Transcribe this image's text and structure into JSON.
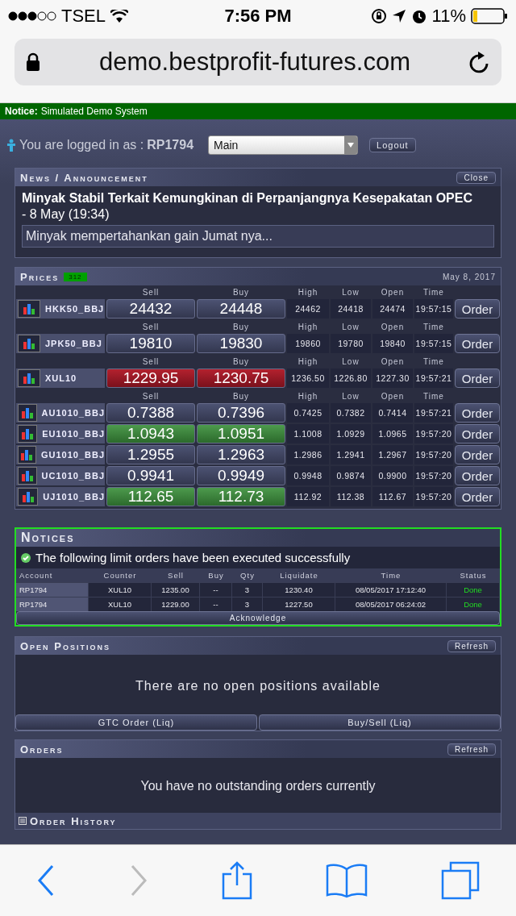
{
  "status_bar": {
    "carrier": "TSEL",
    "time": "7:56 PM",
    "battery": "11%"
  },
  "address_bar": {
    "url": "demo.bestprofit-futures.com"
  },
  "notice_bar": {
    "label": "Notice:",
    "text": "Simulated Demo System"
  },
  "login": {
    "prefix": "You are logged in as :",
    "account": "RP1794",
    "account_select": "Main",
    "logout": "Logout"
  },
  "news": {
    "title": "News / Announcement",
    "close": "Close",
    "headline": "Minyak Stabil Terkait Kemungkinan di Perpanjangnya Kesepakatan OPEC",
    "date": "- 8 May (19:34)",
    "summary": "Minyak mempertahankan gain Jumat nya..."
  },
  "prices": {
    "title": "Prices",
    "badge": "312",
    "date": "May 8, 2017",
    "rows": [
      {
        "headers": [
          "Sell",
          "Buy",
          "High",
          "Low",
          "Open",
          "Time"
        ],
        "symbol": "HKK50_BBJ",
        "sell": "24432",
        "buy": "24448",
        "high": "24462",
        "low": "24418",
        "open": "24474",
        "time": "19:57:15",
        "kind": "plain",
        "order": "Order"
      },
      {
        "headers": [
          "Sell",
          "Buy",
          "High",
          "Low",
          "Open",
          "Time"
        ],
        "symbol": "JPK50_BBJ",
        "sell": "19810",
        "buy": "19830",
        "high": "19860",
        "low": "19780",
        "open": "19840",
        "time": "19:57:15",
        "kind": "plain",
        "order": "Order"
      },
      {
        "headers": [
          "Sell",
          "Buy",
          "High",
          "Low",
          "Open",
          "Time"
        ],
        "symbol": "XUL10",
        "sell": "1229.95",
        "buy": "1230.75",
        "high": "1236.50",
        "low": "1226.80",
        "open": "1227.30",
        "time": "19:57:21",
        "kind": "down",
        "order": "Order"
      },
      {
        "headers": [
          "Sell",
          "Buy",
          "High",
          "Low",
          "Open",
          "Time"
        ],
        "symbol": "AU1010_BBJ",
        "sell": "0.7388",
        "buy": "0.7396",
        "high": "0.7425",
        "low": "0.7382",
        "open": "0.7414",
        "time": "19:57:21",
        "kind": "plain",
        "order": "Order"
      },
      {
        "symbol": "EU1010_BBJ",
        "sell": "1.0943",
        "buy": "1.0951",
        "high": "1.1008",
        "low": "1.0929",
        "open": "1.0965",
        "time": "19:57:20",
        "kind": "up",
        "order": "Order"
      },
      {
        "symbol": "GU1010_BBJ",
        "sell": "1.2955",
        "buy": "1.2963",
        "high": "1.2986",
        "low": "1.2941",
        "open": "1.2967",
        "time": "19:57:20",
        "kind": "plain",
        "order": "Order"
      },
      {
        "symbol": "UC1010_BBJ",
        "sell": "0.9941",
        "buy": "0.9949",
        "high": "0.9948",
        "low": "0.9874",
        "open": "0.9900",
        "time": "19:57:20",
        "kind": "plain",
        "order": "Order"
      },
      {
        "symbol": "UJ1010_BBJ",
        "sell": "112.65",
        "buy": "112.73",
        "high": "112.92",
        "low": "112.38",
        "open": "112.67",
        "time": "19:57:20",
        "kind": "up",
        "order": "Order"
      }
    ]
  },
  "notices": {
    "title": "Notices",
    "message": "The following limit orders have been executed successfully",
    "columns": [
      "Account",
      "Counter",
      "Sell",
      "Buy",
      "Qty",
      "Liquidate",
      "Time",
      "Status"
    ],
    "rows": [
      {
        "cells": [
          "RP1794",
          "XUL10",
          "1235.00",
          "--",
          "3",
          "1230.40",
          "08/05/2017 17:12:40"
        ],
        "status": "Done"
      },
      {
        "cells": [
          "RP1794",
          "XUL10",
          "1229.00",
          "--",
          "3",
          "1227.50",
          "08/05/2017 06:24:02"
        ],
        "status": "Done"
      }
    ],
    "acknowledge": "Acknowledge"
  },
  "open_positions": {
    "title": "Open Positions",
    "refresh": "Refresh",
    "message": "There are no open positions available",
    "buttons": [
      "GTC Order (Liq)",
      "Buy/Sell (Liq)"
    ]
  },
  "orders": {
    "title": "Orders",
    "refresh": "Refresh",
    "message": "You have no outstanding orders currently"
  },
  "order_history": {
    "title": "Order History"
  }
}
